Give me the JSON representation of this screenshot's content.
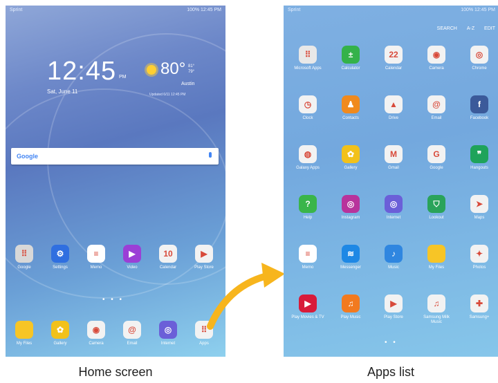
{
  "home": {
    "status": {
      "carrier": "Sprint",
      "right": "100% 12:45 PM"
    },
    "clock": {
      "time": "12:45",
      "ampm": "PM",
      "date": "Sat, June 11"
    },
    "weather": {
      "temp": "80°",
      "unit": "F",
      "hilo": "81°\n79°",
      "city": "Austin",
      "updated": "Updated 6/11 12:45 PM"
    },
    "search": {
      "logo": "Google"
    },
    "apps": [
      {
        "name": "Google",
        "color": "#d8d8d8",
        "glyph": "⠿"
      },
      {
        "name": "Settings",
        "color": "#2f6fe0",
        "glyph": "⚙"
      },
      {
        "name": "Memo",
        "color": "#ffffff",
        "glyph": "≡"
      },
      {
        "name": "Video",
        "color": "#9b3fd6",
        "glyph": "▶"
      },
      {
        "name": "Calendar",
        "color": "#f2f2f2",
        "glyph": "10"
      },
      {
        "name": "Play Store",
        "color": "#f2f2f2",
        "glyph": "▶"
      }
    ],
    "dock": [
      {
        "name": "My Files",
        "color": "#f7c526",
        "glyph": ""
      },
      {
        "name": "Gallery",
        "color": "#f2c11a",
        "glyph": "✿"
      },
      {
        "name": "Camera",
        "color": "#f2f2f2",
        "glyph": "◉"
      },
      {
        "name": "Email",
        "color": "#f2f2f2",
        "glyph": "@"
      },
      {
        "name": "Internet",
        "color": "#6b5fd8",
        "glyph": "◎"
      },
      {
        "name": "Apps",
        "color": "#f2f2f2",
        "glyph": "⠿"
      }
    ]
  },
  "appsList": {
    "status": {
      "carrier": "Sprint",
      "right": "100% 12:45 PM"
    },
    "toplinks": {
      "search": "SEARCH",
      "az": "A-Z",
      "edit": "EDIT"
    },
    "rows": [
      [
        {
          "name": "Microsoft Apps",
          "color": "#e8e8e8",
          "glyph": "⠿"
        },
        {
          "name": "Calculator",
          "color": "#34b24a",
          "glyph": "±"
        },
        {
          "name": "Calendar",
          "color": "#f2f2f2",
          "glyph": "22"
        },
        {
          "name": "Camera",
          "color": "#f2f2f2",
          "glyph": "◉"
        },
        {
          "name": "Chrome",
          "color": "#f2f2f2",
          "glyph": "◎"
        }
      ],
      [
        {
          "name": "Clock",
          "color": "#f2f2f2",
          "glyph": "◷"
        },
        {
          "name": "Contacts",
          "color": "#f08a1e",
          "glyph": "♟"
        },
        {
          "name": "Drive",
          "color": "#f2f2f2",
          "glyph": "▲"
        },
        {
          "name": "Email",
          "color": "#f2f2f2",
          "glyph": "@"
        },
        {
          "name": "Facebook",
          "color": "#3b5a9a",
          "glyph": "f"
        }
      ],
      [
        {
          "name": "Galaxy Apps",
          "color": "#f2f2f2",
          "glyph": "◍"
        },
        {
          "name": "Gallery",
          "color": "#f2c11a",
          "glyph": "✿"
        },
        {
          "name": "Gmail",
          "color": "#f2f2f2",
          "glyph": "M"
        },
        {
          "name": "Google",
          "color": "#f2f2f2",
          "glyph": "G"
        },
        {
          "name": "Hangouts",
          "color": "#1fa35a",
          "glyph": "❞"
        }
      ],
      [
        {
          "name": "Help",
          "color": "#3ab54a",
          "glyph": "?"
        },
        {
          "name": "Instagram",
          "color": "#b8339c",
          "glyph": "◎"
        },
        {
          "name": "Internet",
          "color": "#6b5fd8",
          "glyph": "◎"
        },
        {
          "name": "Lookout",
          "color": "#2aa35a",
          "glyph": "⛉"
        },
        {
          "name": "Maps",
          "color": "#f2f2f2",
          "glyph": "➤"
        }
      ],
      [
        {
          "name": "Memo",
          "color": "#ffffff",
          "glyph": "≡"
        },
        {
          "name": "Messenger",
          "color": "#1e88e5",
          "glyph": "≋"
        },
        {
          "name": "Music",
          "color": "#2f86e0",
          "glyph": "♪"
        },
        {
          "name": "My Files",
          "color": "#f7c526",
          "glyph": ""
        },
        {
          "name": "Photos",
          "color": "#f2f2f2",
          "glyph": "✦"
        }
      ],
      [
        {
          "name": "Play Movies & TV",
          "color": "#d81b3a",
          "glyph": "▶"
        },
        {
          "name": "Play Music",
          "color": "#f27a1f",
          "glyph": "♫"
        },
        {
          "name": "Play Store",
          "color": "#f2f2f2",
          "glyph": "▶"
        },
        {
          "name": "Samsung Milk Music",
          "color": "#f2f2f2",
          "glyph": "♫"
        },
        {
          "name": "Samsung+",
          "color": "#f2f2f2",
          "glyph": "✚"
        }
      ]
    ]
  },
  "captions": {
    "home": "Home screen",
    "apps": "Apps list"
  },
  "arrowColor": "#f7b51d"
}
